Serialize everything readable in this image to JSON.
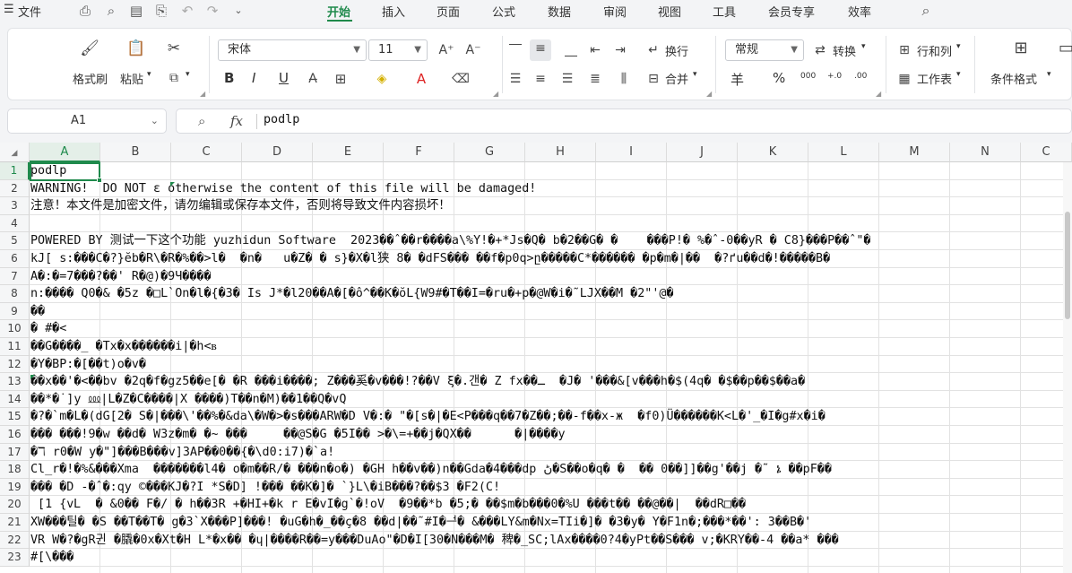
{
  "menu": {
    "file_label": "文件",
    "tabs": [
      "开始",
      "插入",
      "页面",
      "公式",
      "数据",
      "审阅",
      "视图",
      "工具",
      "会员专享",
      "效率"
    ],
    "active_tab": "开始"
  },
  "ribbon": {
    "format_painter": "格式刷",
    "paste": "粘贴",
    "font_name": "宋体",
    "font_size": "11",
    "wrap": "换行",
    "merge": "合并",
    "number_format": "常规",
    "convert": "转换",
    "row_col": "行和列",
    "worksheet": "工作表",
    "cond_format": "条件格式",
    "bold": "B",
    "italic": "I",
    "underline": "U",
    "currency": "羊",
    "percent": "%",
    "thousand": "000",
    "inc_dec": "+.0",
    "dec_dec": ".00"
  },
  "formula_bar": {
    "cell_ref": "A1",
    "fx": "fx",
    "content": "podlp"
  },
  "columns": [
    "A",
    "B",
    "C",
    "D",
    "E",
    "F",
    "G",
    "H",
    "I",
    "J",
    "K",
    "L",
    "M",
    "N",
    "C"
  ],
  "rows": [
    {
      "n": "1",
      "text": "podlp"
    },
    {
      "n": "2",
      "text": "WARNING!  DO NOT ε otherwise the content of this file will be damaged!"
    },
    {
      "n": "3",
      "text": "注意！本文件是加密文件，请勿编辑或保存本文件，否则将导致文件内容损坏！"
    },
    {
      "n": "4",
      "text": ""
    },
    {
      "n": "5",
      "text": "POWERED BY 测试一下这个功能 yuzhidun Software  2023��ˆ��r����a\\%Y!�+*Js�Q� b�2��G� �    ���P!� %�ˆ-0��yR � C8}���P��ˆ\"�"
    },
    {
      "n": "6",
      "text": "kJ[ s:���C�?}ĕb�R\\�R�%��>l�  �n�   u�Z� � s}�X�l狭 8� �dFS��� ��f�p0q>ը�����C*������ �p�m�|��  �?ґu��d�!�����B�"
    },
    {
      "n": "7",
      "text": "A�:�=7���?��' R�@)�9Ч����"
    },
    {
      "n": "8",
      "text": "n:���� Q0�& �5z �□L`On�l�{�3� Is J*�l20��A�[�ô^��K�ŏL{W9#�T��I=�ru�+p�@W�i�˜LJX��M �2\"'@�"
    },
    {
      "n": "9",
      "text": "��"
    },
    {
      "n": "10",
      "text": "� #�<"
    },
    {
      "n": "11",
      "text": "��G����_ �Tx�x������i|�h<ᏼ"
    },
    {
      "n": "12",
      "text": "�Y�BP:�[��t)o�v�"
    },
    {
      "n": "13",
      "text": "��x��'�<��bv �2q�f�gz5��e[� �R ���i����; Z���奚�v���!?��V ξ�.갠� Z fx��ـ  �J� '���&[v���h�$(4q� �$��p��$��a�"
    },
    {
      "n": "14",
      "text": "��*�˙]y ⅏|L�Z�C����|X ����)T��n�M)��1��Q�vQ"
    },
    {
      "n": "15",
      "text": "�?�`m�L�(dG[2� S�|���\\'��%�&da\\�W�>�s���ARW�D V�:� \"�[s�|�E<P���q��7�Z��;��-f��x-ж  �f0)Ü������K<L�'_�I�g#x�i�"
    },
    {
      "n": "16",
      "text": "��� ���!9�w ��d� W3z�m� �~ ���     ��@S�G �5I�� >�\\=+��j�QX��      �|����y"
    },
    {
      "n": "17",
      "text": "�ℸ r0�W y�\"]���B���v]3AP��0��{�\\d0:i7)�`a!"
    },
    {
      "n": "18",
      "text": "Cl_r�!�%&���Xma  �������l4� o�m��R/� ���n�o�) �GH h��v��)n��Gda�4���dp ڻ�S��o�q� �  �� 0��]]��g'��j �˜ ኔ ��pF��"
    },
    {
      "n": "19",
      "text": "��� �D -�ˆ�:qy ©���KJ�?I *S�D] !��� ��K�]� `}L\\�iB���?��$3 �F2(C!"
    },
    {
      "n": "20",
      "text": " [1 {vԼ  � &0�� F�/ � h��3R +�HI+�k r E�vI�g`�!oV  �9��*b �5;� ��$m�b���0�%U ���t�� ��@��|  ��dR□��"
    },
    {
      "n": "21",
      "text": "XW���틸� �S ��T��T� g�3`X���P]���! �uG�h�_��ç�8 ��d|��˜#I�ᅼ� &���LY&m�Nx=TIi�]� �3�y� Y�F1n�;���*��': 3��B�'"
    },
    {
      "n": "22",
      "text": "VR W�?�gR귄 �膬�0x�Xt�H L*�x�� �ɥ|����R��=y���DuAo\"�D�I[30�N���M� 稗�_SC;lAx����0?4�yPt��S��� v;�KRY��-4 ��a* ���"
    },
    {
      "n": "23",
      "text": "#[\\���"
    }
  ]
}
